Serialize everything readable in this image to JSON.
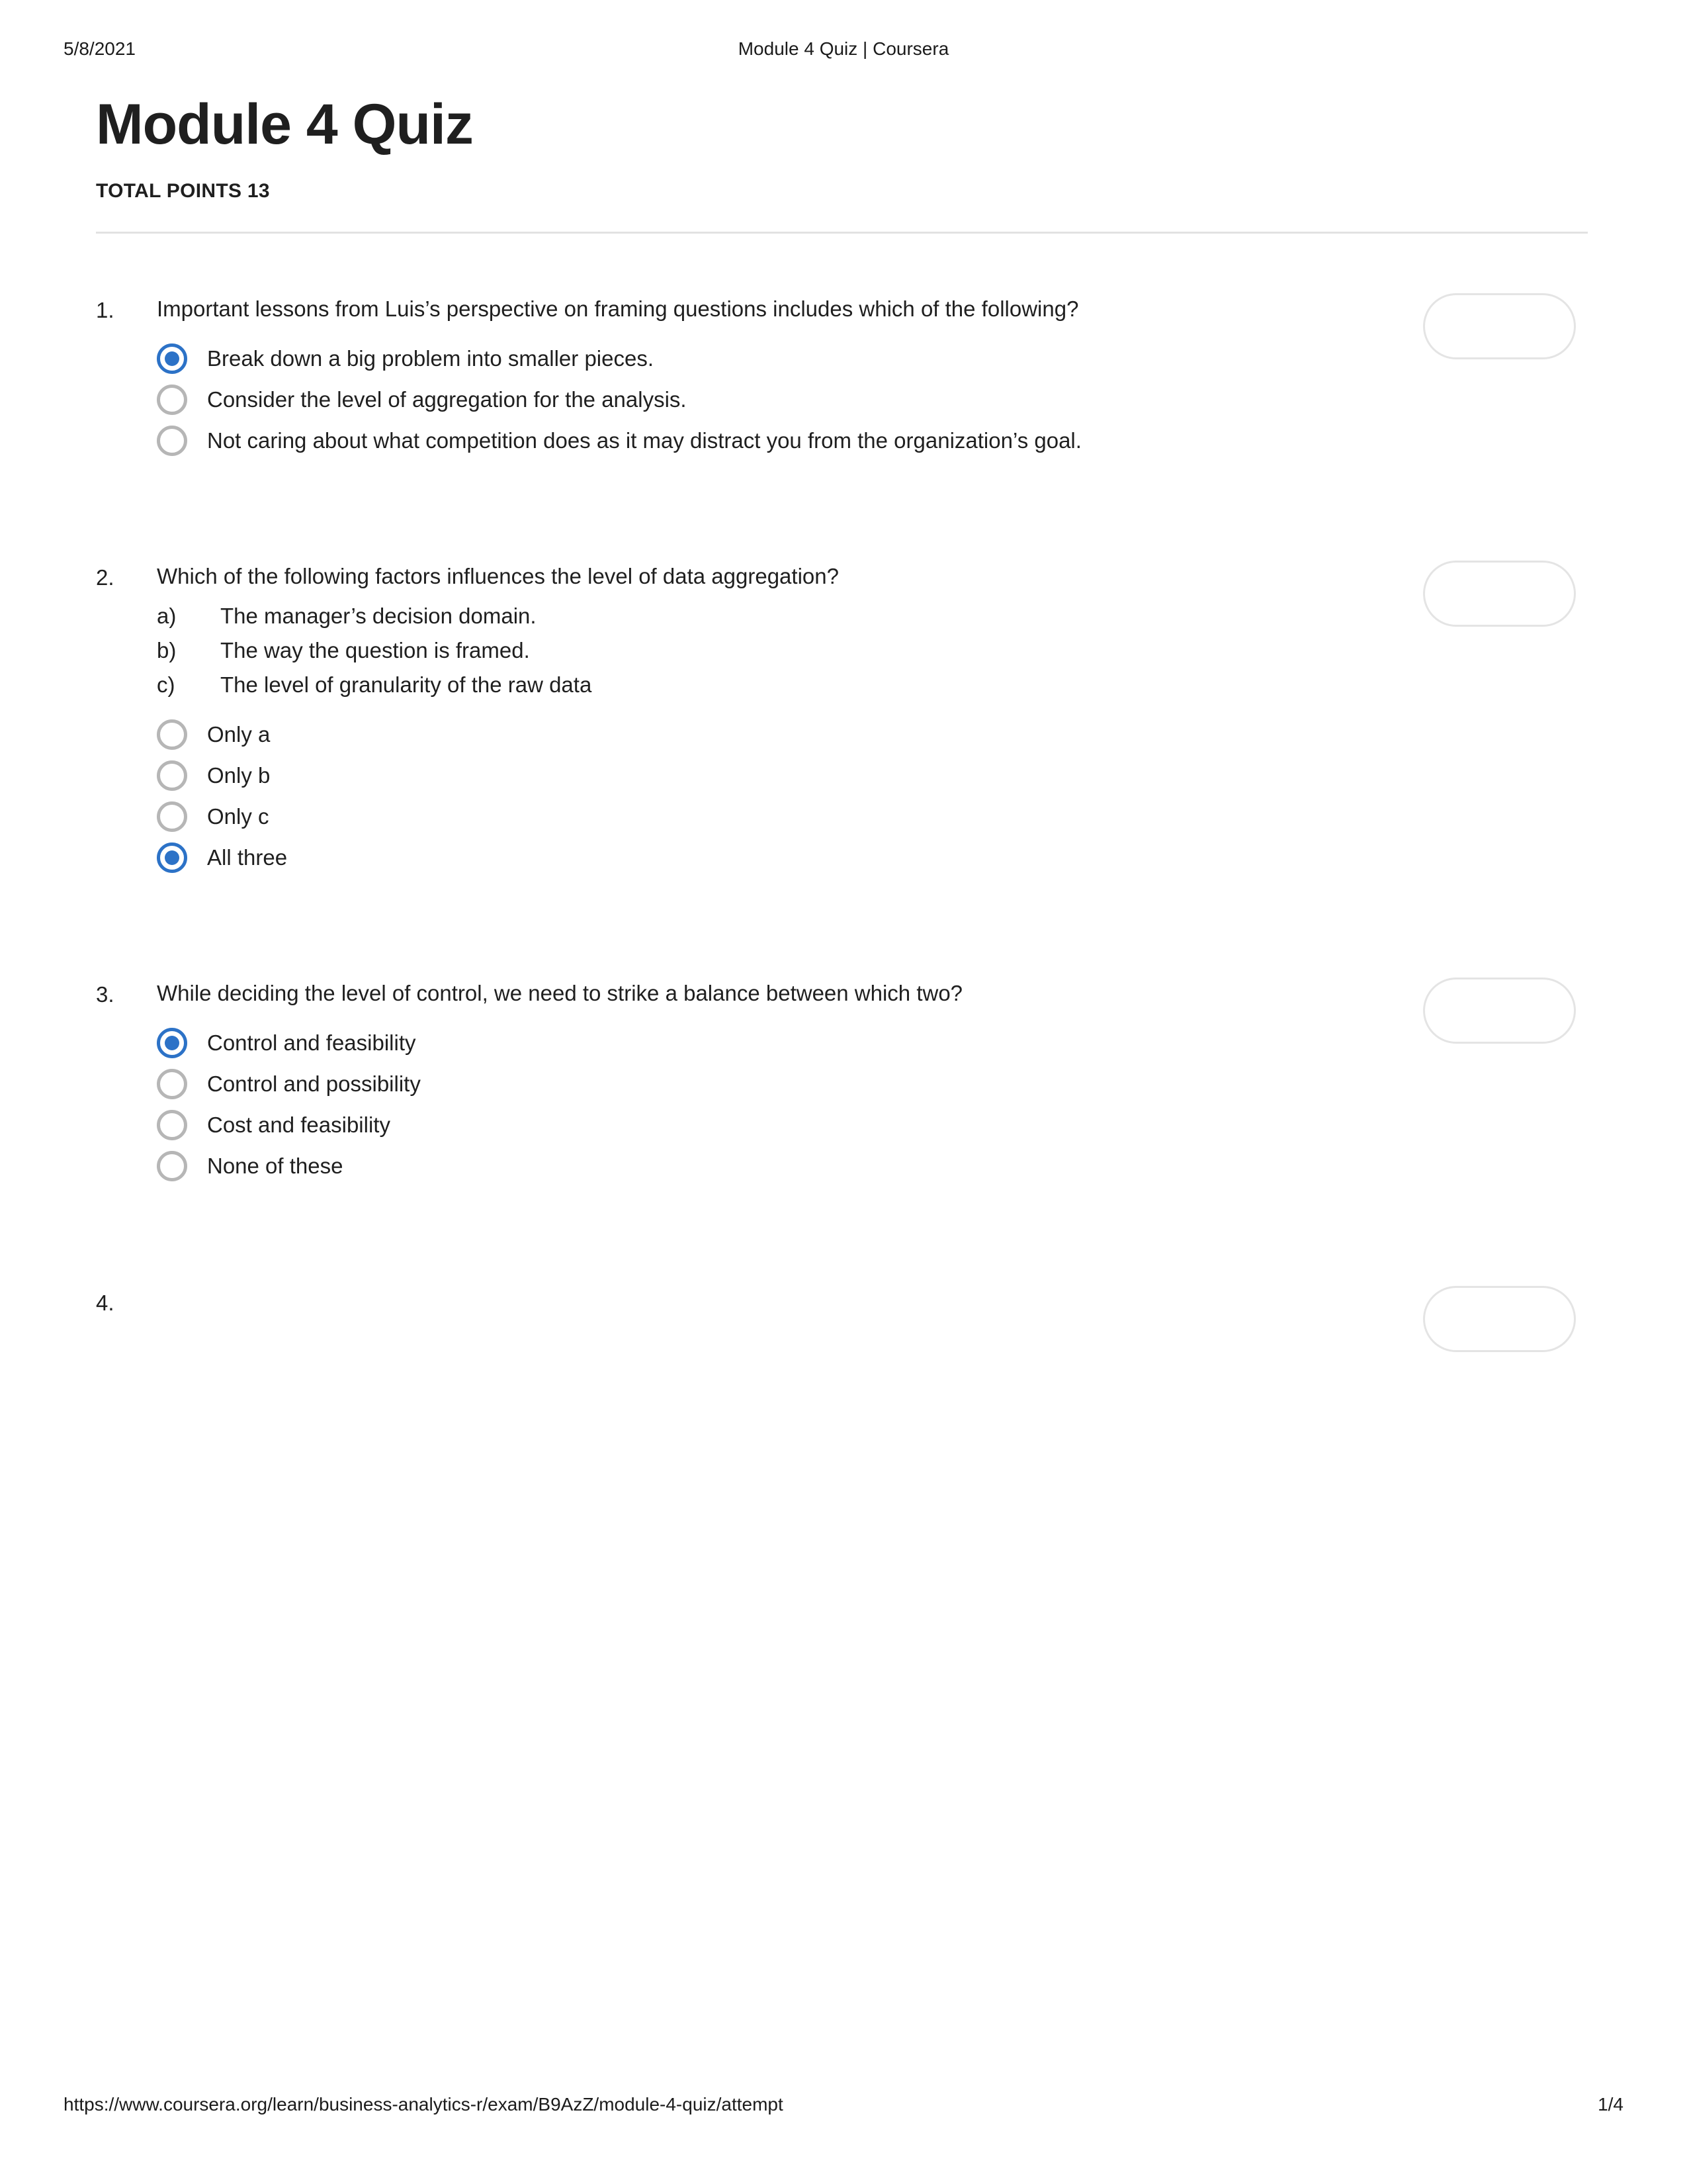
{
  "print_header": {
    "date": "5/8/2021",
    "document_title": "Module 4 Quiz | Coursera"
  },
  "quiz": {
    "title": "Module 4 Quiz",
    "total_points_label": "TOTAL POINTS 13"
  },
  "questions": [
    {
      "number": "1.",
      "text": "Important lessons from Luis’s perspective on framing questions includes which of the following?",
      "points_badge": "",
      "sub_items": [],
      "options": [
        {
          "label": "Break down a big problem into smaller pieces.",
          "selected": true
        },
        {
          "label": "Consider the level of aggregation for the analysis.",
          "selected": false
        },
        {
          "label": "Not caring about what competition does as it may distract you from the organization’s goal.",
          "selected": false
        }
      ]
    },
    {
      "number": "2.",
      "text": "Which of the following factors influences the level of data aggregation?",
      "points_badge": "",
      "sub_items": [
        {
          "letter": "a)",
          "text": "The manager’s decision domain."
        },
        {
          "letter": "b)",
          "text": "The way the question is framed."
        },
        {
          "letter": "c)",
          "text": "The level of granularity of the raw data"
        }
      ],
      "options": [
        {
          "label": "Only a",
          "selected": false
        },
        {
          "label": "Only b",
          "selected": false
        },
        {
          "label": "Only c",
          "selected": false
        },
        {
          "label": "All three",
          "selected": true
        }
      ]
    },
    {
      "number": "3.",
      "text": "While deciding the level of control, we need to strike a balance between which two?",
      "points_badge": "",
      "sub_items": [],
      "options": [
        {
          "label": "Control and feasibility",
          "selected": true
        },
        {
          "label": "Control and possibility",
          "selected": false
        },
        {
          "label": "Cost and feasibility",
          "selected": false
        },
        {
          "label": "None of these",
          "selected": false
        }
      ]
    },
    {
      "number": "4.",
      "text": "",
      "points_badge": "",
      "sub_items": [],
      "options": []
    }
  ],
  "print_footer": {
    "url": "https://www.coursera.org/learn/business-analytics-r/exam/B9AzZ/module-4-quiz/attempt",
    "page": "1/4"
  },
  "colors": {
    "accent": "#2c72c7",
    "radio_unselected": "#b6b6b6",
    "divider": "#e2e2e2",
    "pill_border": "#e4e4e4",
    "text": "#1f1f1f"
  }
}
